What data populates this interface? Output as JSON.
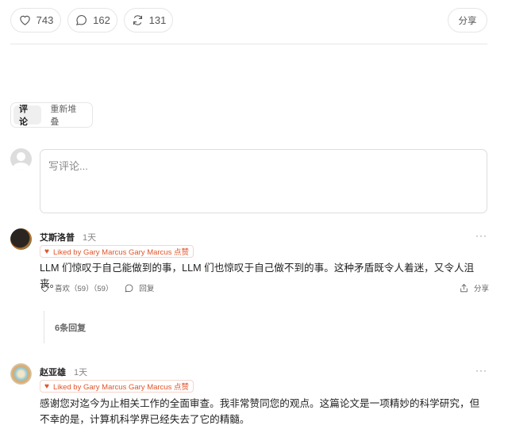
{
  "toolbar": {
    "likes": "743",
    "comments": "162",
    "restacks": "131",
    "share_label": "分享"
  },
  "tabs": [
    {
      "label": "评论",
      "active": true
    },
    {
      "label": "重新堆叠",
      "active": false
    }
  ],
  "comment_box": {
    "placeholder": "写评论..."
  },
  "comments": [
    {
      "author": "艾斯洛普",
      "time": "1天",
      "liked_by": "Liked by Gary Marcus Gary Marcus 点赞",
      "text": "LLM 们惊叹于自己能做到的事，LLM 们也惊叹于自己做不到的事。这种矛盾既令人着迷，又令人沮丧。",
      "like_label": "喜欢（59）（59）",
      "reply_label": "回复",
      "share_label": "分享",
      "replies_label": "6条回复"
    },
    {
      "author": "赵亚雄",
      "time": "1天",
      "liked_by": "Liked by Gary Marcus Gary Marcus 点赞",
      "text": "感谢您对迄今为止相关工作的全面审查。我非常赞同您的观点。这篇论文是一项精妙的科学研究，但不幸的是，计算机科学界已经失去了它的精髓。"
    }
  ],
  "colors": {
    "accent": "#e0552b"
  }
}
